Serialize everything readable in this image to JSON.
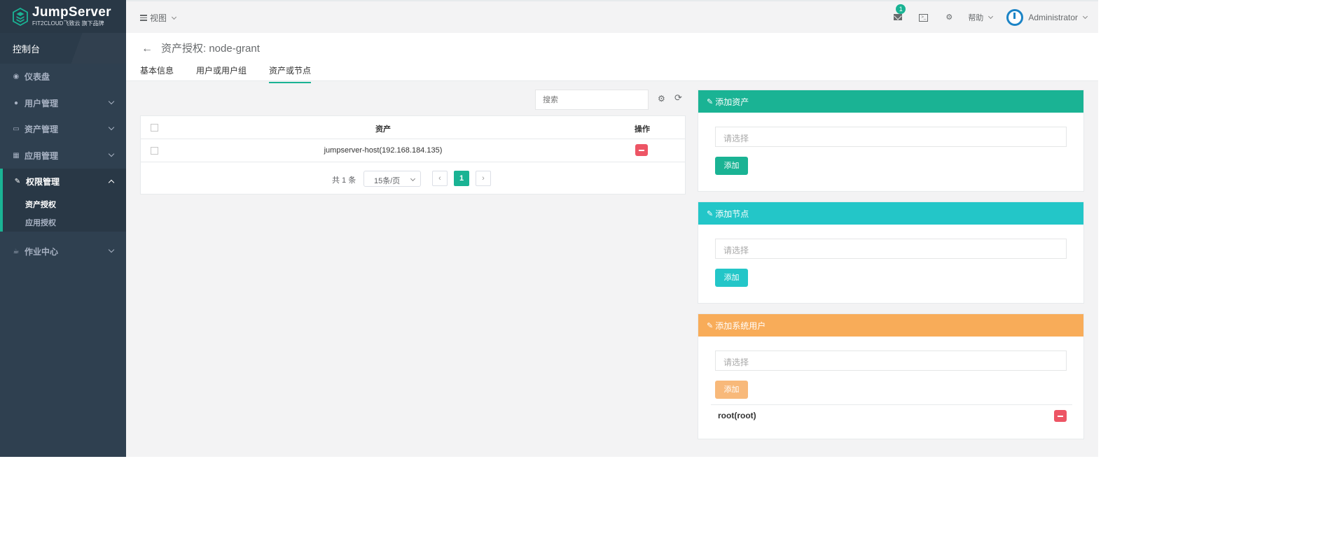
{
  "brand": {
    "name": "JumpServer",
    "tagline": "FIT2CLOUD飞致云 旗下品牌"
  },
  "sidebar": {
    "console": "控制台",
    "items": [
      {
        "label": "仪表盘",
        "icon": "dashboard-icon"
      },
      {
        "label": "用户管理",
        "icon": "users-icon"
      },
      {
        "label": "资产管理",
        "icon": "inbox-icon"
      },
      {
        "label": "应用管理",
        "icon": "grid-icon"
      },
      {
        "label": "权限管理",
        "icon": "edit-icon"
      },
      {
        "label": "作业中心",
        "icon": "coffee-icon"
      }
    ],
    "sub_items": [
      "资产授权",
      "应用授权"
    ]
  },
  "topbar": {
    "view_menu": "视图",
    "notification_count": "1",
    "help_menu": "帮助",
    "username": "Administrator"
  },
  "page": {
    "title": "资产授权: node-grant",
    "tabs": [
      "基本信息",
      "用户或用户组",
      "资产或节点"
    ],
    "active_tab": 2
  },
  "table": {
    "search_placeholder": "搜索",
    "headers": {
      "asset": "资产",
      "action": "操作"
    },
    "rows": [
      {
        "asset": "jumpserver-host(192.168.184.135)"
      }
    ],
    "pagination": {
      "total": "共 1 条",
      "page_size": "15条/页",
      "current": "1",
      "prev": "‹",
      "next": "›"
    }
  },
  "cards": {
    "add_asset": {
      "title": "添加资产",
      "placeholder": "请选择",
      "button": "添加",
      "color": "#1ab394"
    },
    "add_node": {
      "title": "添加节点",
      "placeholder": "请选择",
      "button": "添加",
      "color": "#23c6c8"
    },
    "add_system_user": {
      "title": "添加系统用户",
      "placeholder": "请选择",
      "button": "添加",
      "color": "#f8ac59",
      "items": [
        "root(root)"
      ]
    }
  }
}
